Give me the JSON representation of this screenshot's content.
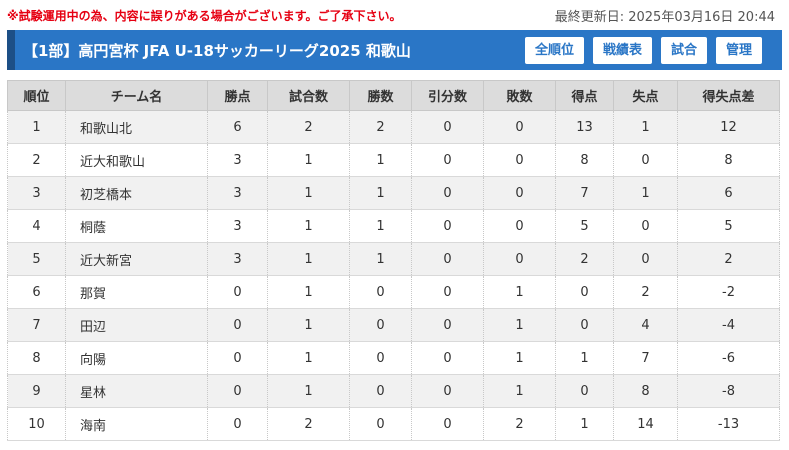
{
  "notice": "※試験運用中の為、内容に誤りがある場合がございます。ご了承下さい。",
  "last_updated": "最終更新日: 2025年03月16日 20:44",
  "header": {
    "title": "【1部】高円宮杯 JFA U-18サッカーリーグ2025 和歌山"
  },
  "nav": [
    {
      "label": "全順位"
    },
    {
      "label": "戦績表"
    },
    {
      "label": "試合"
    },
    {
      "label": "管理"
    }
  ],
  "colors": {
    "header_bg": "#2a76c6",
    "header_accent": "#1d4f86",
    "notice": "#e60012"
  },
  "table": {
    "columns": [
      "順位",
      "チーム名",
      "勝点",
      "試合数",
      "勝数",
      "引分数",
      "敗数",
      "得点",
      "失点",
      "得失点差"
    ],
    "rows": [
      [
        "1",
        "和歌山北",
        "6",
        "2",
        "2",
        "0",
        "0",
        "13",
        "1",
        "12"
      ],
      [
        "2",
        "近大和歌山",
        "3",
        "1",
        "1",
        "0",
        "0",
        "8",
        "0",
        "8"
      ],
      [
        "3",
        "初芝橋本",
        "3",
        "1",
        "1",
        "0",
        "0",
        "7",
        "1",
        "6"
      ],
      [
        "4",
        "桐蔭",
        "3",
        "1",
        "1",
        "0",
        "0",
        "5",
        "0",
        "5"
      ],
      [
        "5",
        "近大新宮",
        "3",
        "1",
        "1",
        "0",
        "0",
        "2",
        "0",
        "2"
      ],
      [
        "6",
        "那賀",
        "0",
        "1",
        "0",
        "0",
        "1",
        "0",
        "2",
        "-2"
      ],
      [
        "7",
        "田辺",
        "0",
        "1",
        "0",
        "0",
        "1",
        "0",
        "4",
        "-4"
      ],
      [
        "8",
        "向陽",
        "0",
        "1",
        "0",
        "0",
        "1",
        "1",
        "7",
        "-6"
      ],
      [
        "9",
        "星林",
        "0",
        "1",
        "0",
        "0",
        "1",
        "0",
        "8",
        "-8"
      ],
      [
        "10",
        "海南",
        "0",
        "2",
        "0",
        "0",
        "2",
        "1",
        "14",
        "-13"
      ]
    ]
  }
}
